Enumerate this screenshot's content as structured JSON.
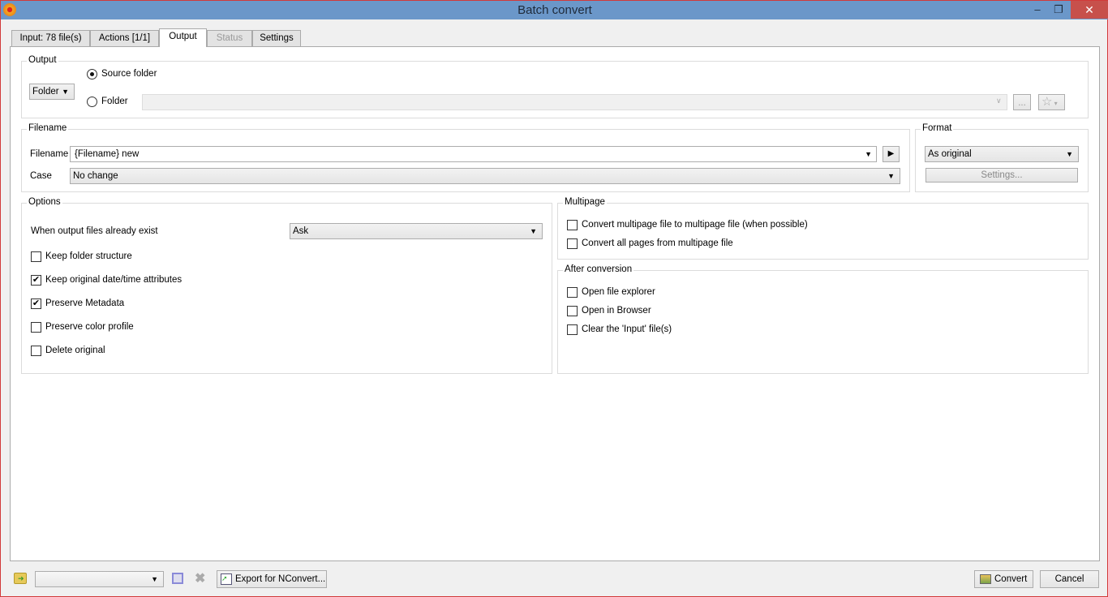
{
  "window": {
    "title": "Batch convert",
    "minimize": "–",
    "restore": "❐",
    "close": "✕"
  },
  "tabs": [
    {
      "label": "Input: 78 file(s)"
    },
    {
      "label": "Actions [1/1]"
    },
    {
      "label": "Output"
    },
    {
      "label": "Status"
    },
    {
      "label": "Settings"
    }
  ],
  "output": {
    "group": "Output",
    "mode": "Folder",
    "source_folder": "Source folder",
    "folder": "Folder",
    "folder_value": "",
    "browse": "...",
    "fav": "☆"
  },
  "filename": {
    "group": "Filename",
    "filename_label": "Filename",
    "filename_value": "{Filename} new",
    "case_label": "Case",
    "case_value": "No change"
  },
  "format": {
    "group": "Format",
    "value": "As original",
    "settings": "Settings..."
  },
  "options": {
    "group": "Options",
    "exist_label": "When output files already exist",
    "exist_value": "Ask",
    "checks": [
      {
        "label": "Keep folder structure",
        "checked": false
      },
      {
        "label": "Keep original date/time attributes",
        "checked": true
      },
      {
        "label": "Preserve Metadata",
        "checked": true
      },
      {
        "label": "Preserve color profile",
        "checked": false
      },
      {
        "label": "Delete original",
        "checked": false
      }
    ]
  },
  "multipage": {
    "group": "Multipage",
    "checks": [
      {
        "label": "Convert multipage file to multipage file (when possible)",
        "checked": false
      },
      {
        "label": "Convert all pages from multipage file",
        "checked": false
      }
    ]
  },
  "after": {
    "group": "After conversion",
    "checks": [
      {
        "label": "Open file explorer",
        "checked": false
      },
      {
        "label": "Open in Browser",
        "checked": false
      },
      {
        "label": "Clear the 'Input' file(s)",
        "checked": false
      }
    ]
  },
  "footer": {
    "preset_value": "",
    "export": "Export for NConvert...",
    "convert": "Convert",
    "cancel": "Cancel"
  }
}
